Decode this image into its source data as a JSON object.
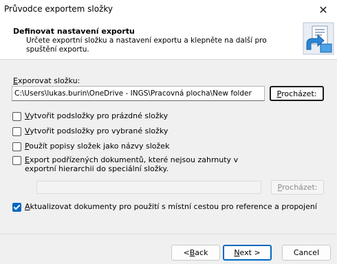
{
  "window": {
    "title": "Průvodce exportem složky",
    "close_glyph": "✕"
  },
  "header": {
    "title": "Definovat nastavení exportu",
    "description": "Určete exportní složku a nastavení exportu a klepněte na další pro spuštění exportu.",
    "icon": "export-wizard-icon"
  },
  "export_folder": {
    "label_accel": "E",
    "label_rest": "xporovat složku:",
    "path": "C:\\Users\\lukas.burin\\OneDrive - INGS\\Pracovná plocha\\New folder",
    "browse_accel": "P",
    "browse_rest": "rocházet:"
  },
  "options": [
    {
      "accel": "V",
      "rest": "ytvořit podsložky pro prázdné složky",
      "checked": false
    },
    {
      "accel": "V",
      "rest": "ytvořit podsložky pro vybrané složky",
      "checked": false
    },
    {
      "accel": "P",
      "rest": "oužít popisy složek jako názvy složek",
      "checked": false
    },
    {
      "accel": "E",
      "rest": "xport podřízených dokumentů, které nejsou zahrnuty v exportní hierarchii do speciální složky.",
      "checked": false
    }
  ],
  "special_folder": {
    "path": "",
    "browse_accel": "P",
    "browse_rest": "rocházet:"
  },
  "update_option": {
    "accel": "A",
    "rest": "ktualizovat dokumenty pro použití s místní cestou pro reference a propojení",
    "checked": true
  },
  "footer": {
    "back_prefix": "< ",
    "back_accel": "B",
    "back_rest": "ack",
    "next_accel": "N",
    "next_rest": "ext >",
    "cancel": "Cancel"
  },
  "colors": {
    "accent": "#0067c0"
  }
}
